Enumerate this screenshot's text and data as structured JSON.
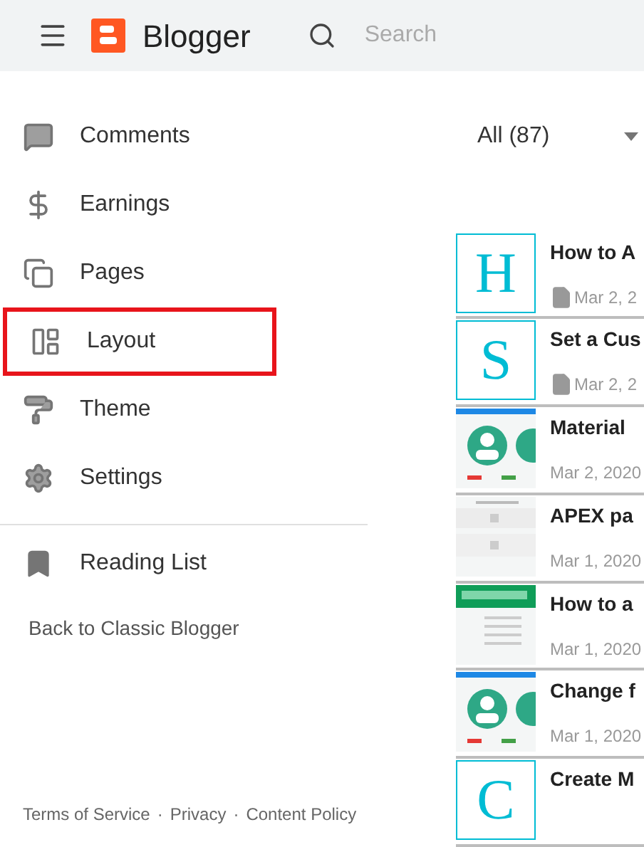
{
  "header": {
    "title": "Blogger",
    "search": {
      "placeholder": "Search"
    }
  },
  "sidebar": {
    "items": [
      {
        "kind": "comments",
        "label": "Comments",
        "highlighted": false
      },
      {
        "kind": "earnings",
        "label": "Earnings",
        "highlighted": false
      },
      {
        "kind": "pages",
        "label": "Pages",
        "highlighted": false
      },
      {
        "kind": "layout",
        "label": "Layout",
        "highlighted": true
      },
      {
        "kind": "theme",
        "label": "Theme",
        "highlighted": false
      },
      {
        "kind": "settings",
        "label": "Settings",
        "highlighted": false
      }
    ],
    "reading_list": "Reading List",
    "back_link": "Back to Classic Blogger",
    "footer_links": [
      "Terms of Service",
      "Privacy",
      "Content Policy"
    ],
    "footer_separator": "·"
  },
  "filter": {
    "label": "All (87)"
  },
  "posts": [
    {
      "thumb": {
        "kind": "letter",
        "letter": "H"
      },
      "title": "How to A",
      "draft": true,
      "date": "Mar 2, 2"
    },
    {
      "thumb": {
        "kind": "letter",
        "letter": "S"
      },
      "title": "Set a Cus",
      "draft": true,
      "date": "Mar 2, 2"
    },
    {
      "title": "Material",
      "draft": false,
      "date": "Mar 2, 2020"
    },
    {
      "title": "APEX pa",
      "draft": false,
      "date": "Mar 1, 2020"
    },
    {
      "title": "How to a",
      "draft": false,
      "date": "Mar 1, 2020"
    },
    {
      "title": "Change f",
      "draft": false,
      "date": "Mar 1, 2020"
    },
    {
      "thumb": {
        "kind": "letter",
        "letter": "C"
      },
      "title": "Create M",
      "draft": false
    }
  ]
}
